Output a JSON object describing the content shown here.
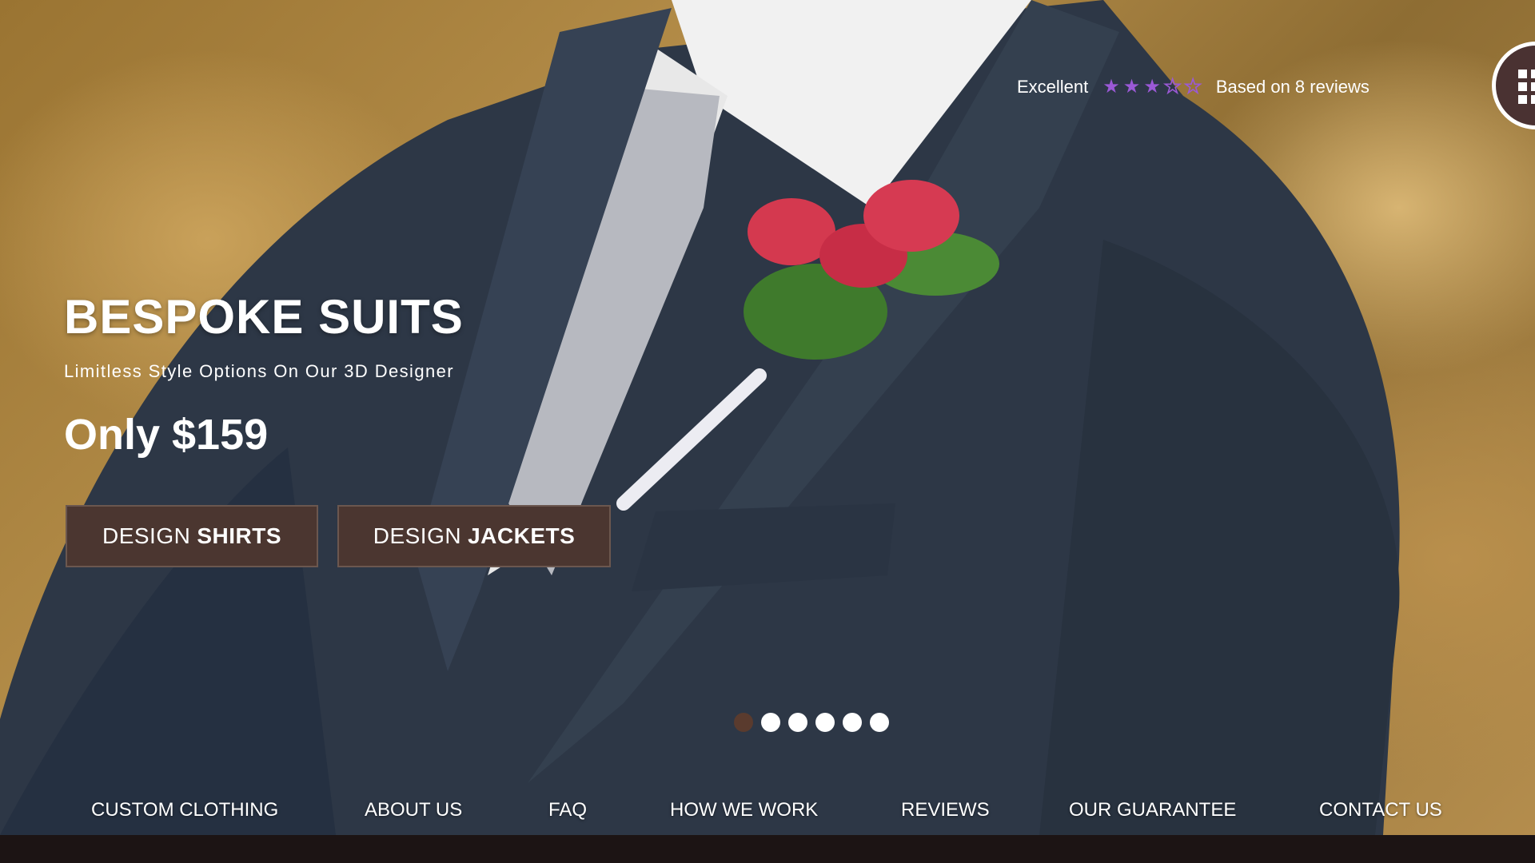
{
  "rating": {
    "label": "Excellent",
    "stars_filled": 3,
    "stars_total": 5,
    "summary": "Based on 8 reviews",
    "star_color": "#9b59d6"
  },
  "menu_badge": {
    "icon": "grid-menu-icon"
  },
  "hero": {
    "title": "BESPOKE SUITS",
    "subtitle": "Limitless Style Options On Our 3D Designer",
    "price": "Only $159",
    "buttons": [
      {
        "prefix": "DESIGN",
        "bold": "SHIRTS"
      },
      {
        "prefix": "DESIGN",
        "bold": "JACKETS"
      }
    ]
  },
  "carousel": {
    "total": 6,
    "active": 1
  },
  "nav": {
    "items": [
      "CUSTOM CLOTHING",
      "ABOUT US",
      "FAQ",
      "HOW WE WORK",
      "REVIEWS",
      "OUR GUARANTEE",
      "CONTACT US"
    ]
  },
  "colors": {
    "button_bg": "#4b3630",
    "active_dot": "#5a3b2e",
    "bottom_bar": "#1c1414"
  }
}
